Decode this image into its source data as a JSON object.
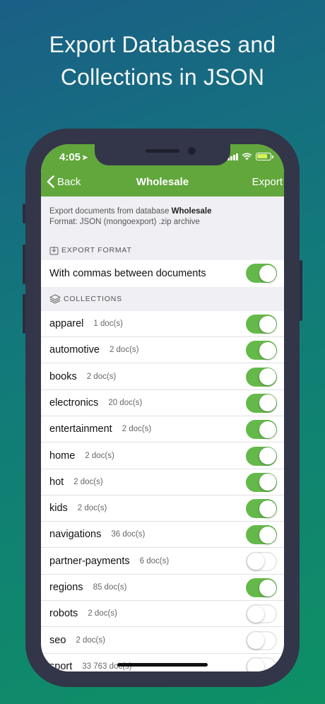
{
  "headline": {
    "line1": "Export Databases and",
    "line2": "Collections in JSON"
  },
  "status_bar": {
    "time": "4:05"
  },
  "nav": {
    "back_label": "Back",
    "title": "Wholesale",
    "export_label": "Export"
  },
  "info": {
    "line1_prefix": "Export documents from database ",
    "line1_db": "Wholesale",
    "line2": "Format: JSON (mongoexport) .zip archive"
  },
  "export_format": {
    "header": "EXPORT FORMAT",
    "option_label": "With commas between documents",
    "option_on": true
  },
  "collections": {
    "header": "COLLECTIONS",
    "items": [
      {
        "name": "apparel",
        "count": "1 doc(s)",
        "on": true
      },
      {
        "name": "automotive",
        "count": "2 doc(s)",
        "on": true
      },
      {
        "name": "books",
        "count": "2 doc(s)",
        "on": true
      },
      {
        "name": "electronics",
        "count": "20 doc(s)",
        "on": true
      },
      {
        "name": "entertainment",
        "count": "2 doc(s)",
        "on": true
      },
      {
        "name": "home",
        "count": "2 doc(s)",
        "on": true
      },
      {
        "name": "hot",
        "count": "2 doc(s)",
        "on": true
      },
      {
        "name": "kids",
        "count": "2 doc(s)",
        "on": true
      },
      {
        "name": "navigations",
        "count": "36 doc(s)",
        "on": true
      },
      {
        "name": "partner-payments",
        "count": "6 doc(s)",
        "on": false
      },
      {
        "name": "regions",
        "count": "85 doc(s)",
        "on": true
      },
      {
        "name": "robots",
        "count": "2 doc(s)",
        "on": false
      },
      {
        "name": "seo",
        "count": "2 doc(s)",
        "on": false
      },
      {
        "name": "sport",
        "count": "33 763 doc(s)",
        "on": false
      }
    ]
  },
  "colors": {
    "nav_green": "#62a73c",
    "toggle_on": "#64b94a",
    "phone_frame": "#333548"
  }
}
